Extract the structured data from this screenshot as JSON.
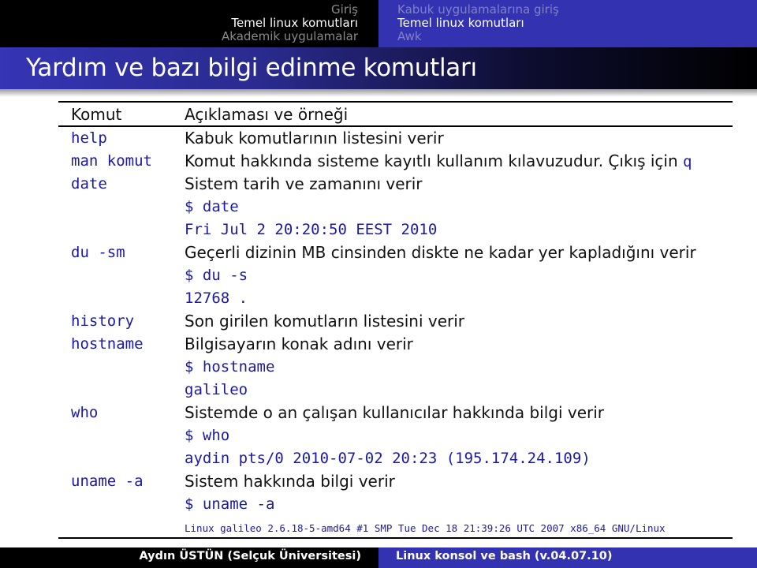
{
  "header": {
    "sections": [
      {
        "label": "Giriş",
        "active": false
      },
      {
        "label": "Temel linux komutları",
        "active": true
      },
      {
        "label": "Akademik uygulamalar",
        "active": false
      }
    ],
    "subsections": [
      {
        "label": "Kabuk uygulamalarına giriş",
        "active": false
      },
      {
        "label": "Temel linux komutları",
        "active": true
      },
      {
        "label": "Awk",
        "active": false
      }
    ]
  },
  "slide": {
    "title": "Yardım ve bazı bilgi edinme komutları"
  },
  "table": {
    "headers": [
      "Komut",
      "Açıklaması ve örneği"
    ],
    "rows": [
      {
        "cmd": "help",
        "desc": "Kabuk komutlarının listesini verir"
      },
      {
        "cmd": "man komut",
        "desc": "Komut hakkında sisteme kayıtlı kullanım kılavuzudur. Çıkış için ",
        "desc_code": "q"
      },
      {
        "cmd": "date",
        "desc": "Sistem tarih ve zamanını verir"
      },
      {
        "cmd": "",
        "code": "$ date"
      },
      {
        "cmd": "",
        "code": "Fri Jul 2 20:20:50 EEST 2010"
      },
      {
        "cmd": "du -sm",
        "desc": "Geçerli dizinin MB cinsinden diskte ne kadar yer kapladığını verir"
      },
      {
        "cmd": "",
        "code": "$ du -s"
      },
      {
        "cmd": "",
        "code": "12768 ."
      },
      {
        "cmd": "history",
        "desc": "Son girilen komutların listesini verir"
      },
      {
        "cmd": "hostname",
        "desc": "Bilgisayarın konak adını verir"
      },
      {
        "cmd": "",
        "code": "$ hostname"
      },
      {
        "cmd": "",
        "code": "galileo"
      },
      {
        "cmd": "who",
        "desc": "Sistemde o an çalışan kullanıcılar hakkında bilgi verir"
      },
      {
        "cmd": "",
        "code": "$ who"
      },
      {
        "cmd": "",
        "code": "aydin pts/0 2010-07-02 20:23 (195.174.24.109)"
      },
      {
        "cmd": "uname -a",
        "desc": "Sistem hakkında bilgi verir"
      },
      {
        "cmd": "",
        "code": "$ uname -a"
      },
      {
        "cmd": "",
        "code_small": "Linux galileo 2.6.18-5-amd64 #1 SMP Tue Dec 18 21:39:26 UTC 2007 x86_64 GNU/Linux"
      }
    ]
  },
  "footer": {
    "author": "Aydın ÜSTÜN (Selçuk Üniversitesi)",
    "presentation": "Linux konsol ve bash (v.04.07.10)"
  }
}
